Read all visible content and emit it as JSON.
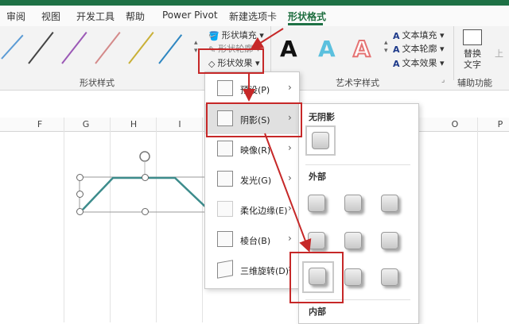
{
  "ribbon_tabs": [
    "审阅",
    "视图",
    "开发工具",
    "帮助",
    "Power Pivot",
    "新建选项卡",
    "形状格式"
  ],
  "shape_styles_group": {
    "label": "形状样式",
    "fill": "形状填充",
    "outline": "形状轮廓",
    "effects": "形状效果"
  },
  "wordart_group": {
    "label": "艺术字样式",
    "sample": "A",
    "text_fill": "文本填充",
    "text_outline": "文本轮廓",
    "text_effects": "文本效果"
  },
  "accessibility_group": {
    "label": "辅助功能",
    "alt_text_line1": "替换",
    "alt_text_line2": "文字",
    "truncated": "上"
  },
  "columns": [
    "F",
    "G",
    "H",
    "I",
    "O",
    "P"
  ],
  "effects_menu": [
    {
      "label": "预设(P)"
    },
    {
      "label": "阴影(S)"
    },
    {
      "label": "映像(R)"
    },
    {
      "label": "发光(G)"
    },
    {
      "label": "柔化边缘(E)"
    },
    {
      "label": "棱台(B)"
    },
    {
      "label": "三维旋转(D)"
    }
  ],
  "shadow_submenu": {
    "no_shadow": "无阴影",
    "outer": "外部",
    "inner": "内部"
  },
  "colors": {
    "brand_green": "#1e7145",
    "highlight_red": "#c62828",
    "line_teal": "#3d8c8c"
  }
}
